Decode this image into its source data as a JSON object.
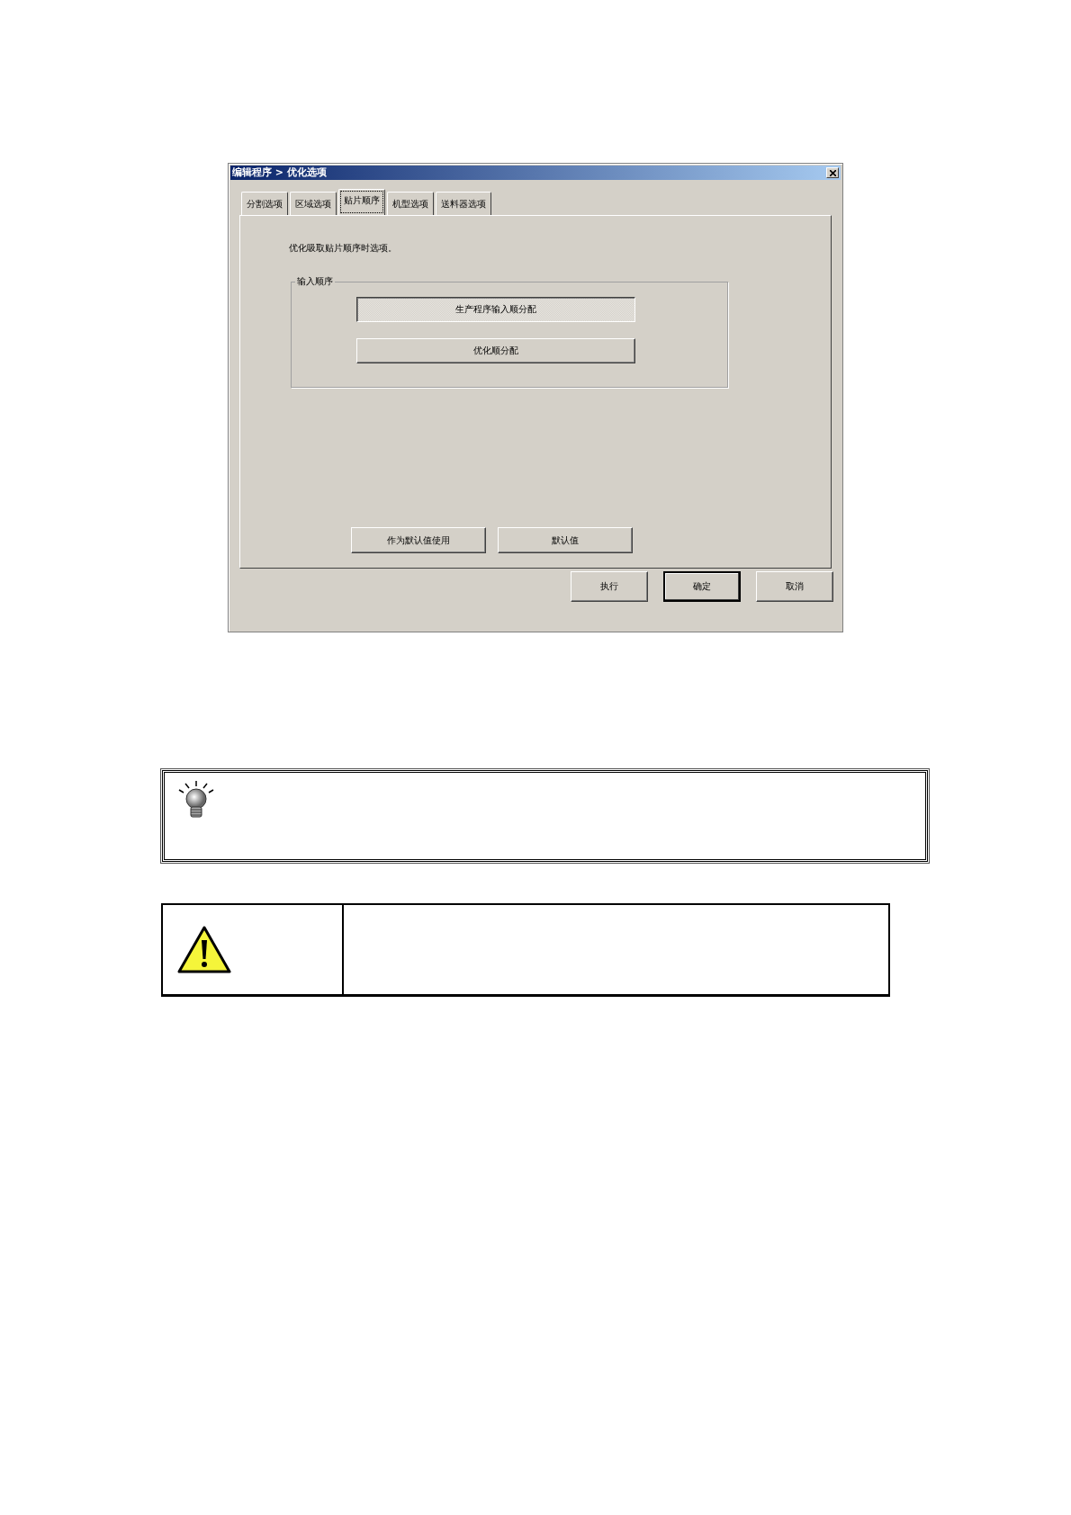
{
  "window": {
    "title": "编辑程序 > 优化选项"
  },
  "tabs": [
    {
      "label": "分割选项",
      "selected": false
    },
    {
      "label": "区域选项",
      "selected": false
    },
    {
      "label": "贴片顺序",
      "selected": true
    },
    {
      "label": "机型选项",
      "selected": false
    },
    {
      "label": "送料器选项",
      "selected": false
    }
  ],
  "description": "优化吸取贴片顺序时选项。",
  "input_order": {
    "title": "输入顺序",
    "options": [
      {
        "label": "生产程序输入顺分配",
        "pressed": true
      },
      {
        "label": "优化顺分配",
        "pressed": false
      }
    ]
  },
  "panel_buttons": [
    "作为默认值使用",
    "默认值"
  ],
  "dialog_buttons": [
    {
      "label": "执行",
      "default": false
    },
    {
      "label": "确定",
      "default": true
    },
    {
      "label": "取消",
      "default": false
    }
  ],
  "notes": [
    {
      "kind": "tip"
    },
    {
      "kind": "warning"
    }
  ]
}
